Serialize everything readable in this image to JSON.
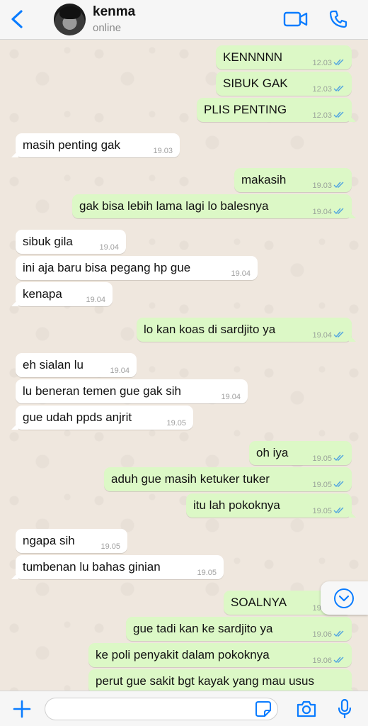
{
  "header": {
    "name": "kenma",
    "status": "online"
  },
  "colors": {
    "accent": "#0a7cff",
    "incoming_bubble": "#ffffff",
    "outgoing_bubble": "#dcf8c6",
    "chat_background": "#efe7de",
    "read_ticks": "#4fa3e0"
  },
  "icons": [
    "back-chevron-icon",
    "video-call-icon",
    "phone-icon",
    "scroll-down-icon",
    "plus-icon",
    "sticker-icon",
    "camera-icon",
    "microphone-icon",
    "read-receipt-icon"
  ],
  "messages": [
    {
      "dir": "out",
      "text": "KENNNNN",
      "time": "12.03"
    },
    {
      "dir": "out",
      "text": "SIBUK GAK",
      "time": "12.03"
    },
    {
      "dir": "out",
      "text": "PLIS PENTING",
      "time": "12.03"
    },
    {
      "dir": "in",
      "text": "masih penting gak",
      "time": "19.03"
    },
    {
      "dir": "out",
      "text": "makasih",
      "time": "19.03"
    },
    {
      "dir": "out",
      "text": "gak bisa lebih lama lagi lo balesnya",
      "time": "19.04"
    },
    {
      "dir": "in",
      "text": "sibuk gila",
      "time": "19.04"
    },
    {
      "dir": "in",
      "text": "ini aja baru bisa pegang hp gue",
      "time": "19.04"
    },
    {
      "dir": "in",
      "text": "kenapa",
      "time": "19.04"
    },
    {
      "dir": "out",
      "text": "lo kan koas di sardjito ya",
      "time": "19.04"
    },
    {
      "dir": "in",
      "text": "eh sialan lu",
      "time": "19.04"
    },
    {
      "dir": "in",
      "text": "lu beneran temen gue gak sih",
      "time": "19.04"
    },
    {
      "dir": "in",
      "text": "gue udah ppds anjrit",
      "time": "19.05"
    },
    {
      "dir": "out",
      "text": "oh iya",
      "time": "19.05"
    },
    {
      "dir": "out",
      "text": "aduh gue masih ketuker tuker",
      "time": "19.05"
    },
    {
      "dir": "out",
      "text": "itu lah pokoknya",
      "time": "19.05"
    },
    {
      "dir": "in",
      "text": "ngapa sih",
      "time": "19.05"
    },
    {
      "dir": "in",
      "text": "tumbenan lu bahas ginian",
      "time": "19.05"
    },
    {
      "dir": "out",
      "text": "SOALNYA",
      "time": "19.05"
    },
    {
      "dir": "out",
      "text": "gue tadi kan ke sardjito ya",
      "time": "19.06"
    },
    {
      "dir": "out",
      "text": "ke poli penyakit dalam pokoknya",
      "time": "19.06"
    },
    {
      "dir": "out",
      "text": "perut gue sakit bgt kayak yang mau usus",
      "time": ""
    }
  ],
  "input": {
    "value": "",
    "placeholder": ""
  }
}
